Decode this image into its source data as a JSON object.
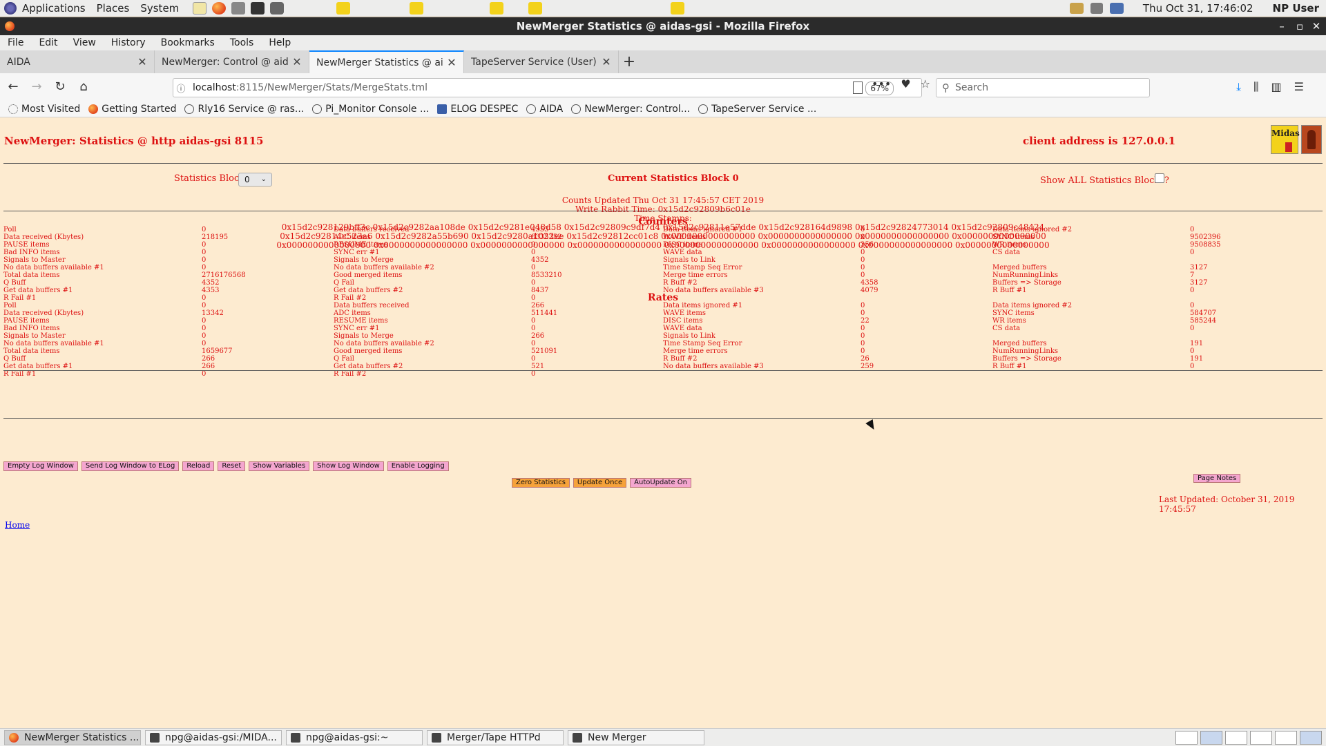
{
  "desktop": {
    "menus": [
      "Applications",
      "Places",
      "System"
    ],
    "clock": "Thu Oct 31, 17:46:02",
    "user": "NP User"
  },
  "window": {
    "title": "NewMerger Statistics @ aidas-gsi - Mozilla Firefox"
  },
  "browser": {
    "menu": [
      "File",
      "Edit",
      "View",
      "History",
      "Bookmarks",
      "Tools",
      "Help"
    ],
    "tabs": [
      {
        "label": "AIDA"
      },
      {
        "label": "NewMerger: Control @ aidas"
      },
      {
        "label": "NewMerger Statistics @ aida"
      },
      {
        "label": "TapeServer Service (User) @"
      }
    ],
    "url_host": "localhost",
    "url_path": ":8115/NewMerger/Stats/MergeStats.tml",
    "zoom": "67%",
    "search_placeholder": "Search",
    "bookmarks": [
      {
        "label": "Most Visited",
        "icon": "gear-icon"
      },
      {
        "label": "Getting Started",
        "icon": "firefox-icon"
      },
      {
        "label": "Rly16 Service @ ras...",
        "icon": "globe-icon"
      },
      {
        "label": "Pi_Monitor Console ...",
        "icon": "globe-icon"
      },
      {
        "label": "ELOG DESPEC",
        "icon": "book-icon"
      },
      {
        "label": "AIDA",
        "icon": "globe-icon"
      },
      {
        "label": "NewMerger: Control...",
        "icon": "globe-icon"
      },
      {
        "label": "TapeServer Service ...",
        "icon": "globe-icon"
      }
    ]
  },
  "page": {
    "title": "NewMerger: Statistics @ http aidas-gsi 8115",
    "client_address": "client address is 127.0.0.1",
    "logo_text": "Midas",
    "stats_block_label": "Statistics Block",
    "stats_block_value": "0",
    "current_block": "Current Statistics Block 0",
    "show_all_label": "Show ALL Statistics Blocks?",
    "counts_updated": "Counts Updated Thu Oct 31 17:45:57 CET 2019",
    "write_rabbit": "Write Rabbit Time: 0x15d2c92809b6c01e",
    "time_stamps_label": "Time Stamps:",
    "time_stamps": [
      "0x15d2c928129bff3c 0x15d2c9282aa108de 0x15d2c9281e048d58 0x15d2c92809c9df7d4 0x15d2c92811e57dde 0x15d2c928164d9898 0x15d2c92824773014 0x15d2c92809c48424",
      "0x15d2c92814c523a6 0x15d2c9282a55b690 0x15d2c9280a1022ee 0x15d2c92812cc01c8 0x0000000000000000 0x0000000000000000 0x0000000000000000 0x0000000000000000",
      "0x0000000000000000 0x0000000000000000 0x0000000000000000 0x0000000000000000 0x0000000000000000 0x0000000000000000 0x0000000000000000 0x0000000000000000"
    ],
    "counters_title": "Counters",
    "rates_title": "Rates",
    "counters": [
      [
        "Poll",
        "0",
        "Data buffers received",
        "4353",
        "Data items ignored #1",
        "0",
        "Data items ignored #2",
        "0"
      ],
      [
        "Data received (Kbytes)",
        "218195",
        "ADC items",
        "8335352",
        "WAVE items",
        "0",
        "SYNC items",
        "9502396"
      ],
      [
        "PAUSE items",
        "0",
        "RESUME items",
        "0",
        "DISC items",
        "356",
        "WR items",
        "9508835"
      ],
      [
        "Bad INFO items",
        "0",
        "SYNC err #1",
        "0",
        "WAVE data",
        "0",
        "CS data",
        "0"
      ],
      [
        "Signals to Master",
        "0",
        "Signals to Merge",
        "4352",
        "Signals to Link",
        "0",
        "",
        ""
      ],
      [
        "No data buffers available #1",
        "0",
        "No data buffers available #2",
        "0",
        "Time Stamp Seq Error",
        "0",
        "Merged buffers",
        "3127"
      ],
      [
        "Total data items",
        "2716176568",
        "Good merged items",
        "8533210",
        "Merge time errors",
        "0",
        "NumRunningLinks",
        "7"
      ],
      [
        "Q Buff",
        "4352",
        "Q Fail",
        "0",
        "R Buff #2",
        "4358",
        "Buffers => Storage",
        "3127"
      ],
      [
        "Get data buffers #1",
        "4353",
        "Get data buffers #2",
        "8437",
        "No data buffers available #3",
        "4079",
        "R Buff #1",
        "0"
      ],
      [
        "R Fail #1",
        "0",
        "R Fail #2",
        "0",
        "",
        "",
        "",
        ""
      ]
    ],
    "rates": [
      [
        "Poll",
        "0",
        "Data buffers received",
        "266",
        "Data items ignored #1",
        "0",
        "Data items ignored #2",
        "0"
      ],
      [
        "Data received (Kbytes)",
        "13342",
        "ADC items",
        "511441",
        "WAVE items",
        "0",
        "SYNC items",
        "584707"
      ],
      [
        "PAUSE items",
        "0",
        "RESUME items",
        "0",
        "DISC items",
        "22",
        "WR items",
        "585244"
      ],
      [
        "Bad INFO items",
        "0",
        "SYNC err #1",
        "0",
        "WAVE data",
        "0",
        "CS data",
        "0"
      ],
      [
        "Signals to Master",
        "0",
        "Signals to Merge",
        "266",
        "Signals to Link",
        "0",
        "",
        ""
      ],
      [
        "No data buffers available #1",
        "0",
        "No data buffers available #2",
        "0",
        "Time Stamp Seq Error",
        "0",
        "Merged buffers",
        "191"
      ],
      [
        "Total data items",
        "1659677",
        "Good merged items",
        "521091",
        "Merge time errors",
        "0",
        "NumRunningLinks",
        "0"
      ],
      [
        "Q Buff",
        "266",
        "Q Fail",
        "0",
        "R Buff #2",
        "26",
        "Buffers => Storage",
        "191"
      ],
      [
        "Get data buffers #1",
        "266",
        "Get data buffers #2",
        "521",
        "No data buffers available #3",
        "259",
        "R Buff #1",
        "0"
      ],
      [
        "R Fail #1",
        "0",
        "R Fail #2",
        "0",
        "",
        "",
        "",
        ""
      ]
    ],
    "buttons": [
      "Empty Log Window",
      "Send Log Window to ELog",
      "Reload",
      "Reset",
      "Show Variables",
      "Show Log Window",
      "Enable Logging"
    ],
    "buttons2": [
      "Zero Statistics",
      "Update Once",
      "AutoUpdate On"
    ],
    "page_notes": "Page Notes",
    "last_updated": "Last Updated: October 31, 2019 17:45:57",
    "home": "Home"
  },
  "taskbar": [
    {
      "label": "NewMerger Statistics ...",
      "icon": "firefox-icon"
    },
    {
      "label": "npg@aidas-gsi:/MIDA...",
      "icon": "terminal-icon"
    },
    {
      "label": "npg@aidas-gsi:~",
      "icon": "terminal-icon"
    },
    {
      "label": "Merger/Tape HTTPd",
      "icon": "terminal-icon"
    },
    {
      "label": "New Merger",
      "icon": "terminal-icon"
    }
  ],
  "colors": {
    "page_bg": "#fdebd0",
    "text_red": "#dd1111",
    "button_pink": "#f4a6cf",
    "button_orange": "#f6a23a"
  }
}
